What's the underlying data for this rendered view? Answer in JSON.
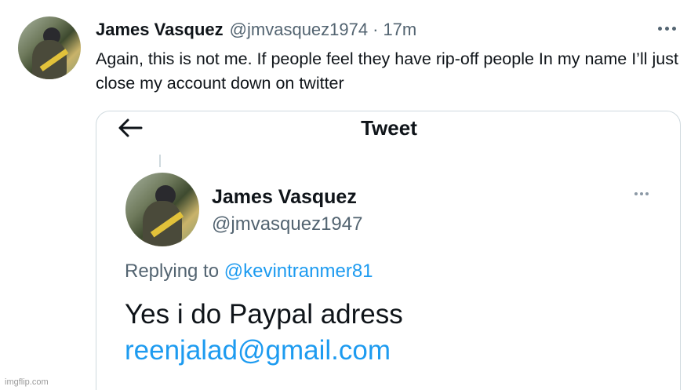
{
  "tweet": {
    "author_name": "James Vasquez",
    "author_handle": "@jmvasquez1974",
    "separator": "·",
    "time": "17m",
    "text": "Again, this is not me. If people feel they have rip-off people In my name I’ll just close my account down on twitter",
    "more_icon": "more-horizontal-icon"
  },
  "quoted_screenshot": {
    "back_icon": "arrow-left-icon",
    "title": "Tweet",
    "author_name": "James Vasquez",
    "author_handle": "@jmvasquez1947",
    "replying_label": "Replying to",
    "replying_to": "@kevintranmer81",
    "body_text": "Yes i do Paypal adress",
    "email": "reenjalad@gmail.com"
  },
  "watermark": "imgflip.com",
  "colors": {
    "text": "#0f1419",
    "muted": "#536471",
    "link": "#1d9bf0",
    "border": "#cfd9de"
  }
}
